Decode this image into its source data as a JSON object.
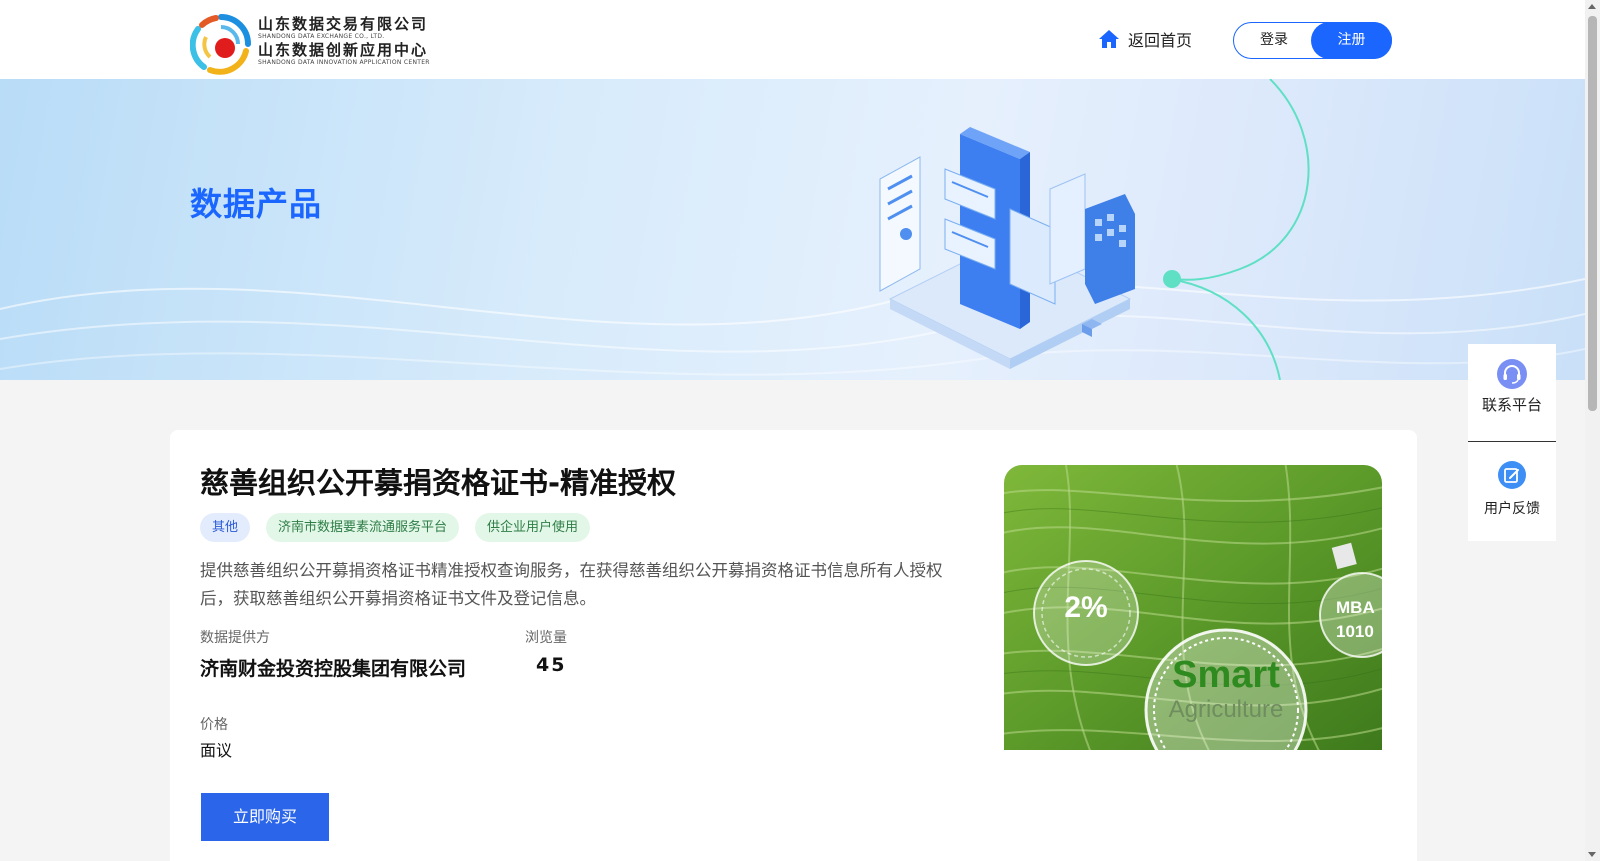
{
  "header": {
    "logo": {
      "line1_cn": "山东数据交易有限公司",
      "line1_en": "SHANDONG DATA EXCHANGE CO., LTD.",
      "line2_cn": "山东数据创新应用中心",
      "line2_en": "SHANDONG DATA INNOVATION APPLICATION CENTER"
    },
    "home_label": "返回首页",
    "login_label": "登录",
    "register_label": "注册"
  },
  "banner": {
    "title": "数据产品"
  },
  "product": {
    "title": "慈善组织公开募捐资格证书-精准授权",
    "tags": [
      {
        "label": "其他",
        "style": "blue"
      },
      {
        "label": "济南市数据要素流通服务平台",
        "style": "green"
      },
      {
        "label": "供企业用户使用",
        "style": "green"
      }
    ],
    "description": "提供慈善组织公开募捐资格证书精准授权查询服务，在获得慈善组织公开募捐资格证书信息所有人授权后，获取慈善组织公开募捐资格证书文件及登记信息。",
    "provider_label": "数据提供方",
    "provider_value": "济南财金投资控股集团有限公司",
    "views_label": "浏览量",
    "views_value": "45",
    "price_label": "价格",
    "price_value": "面议",
    "buy_label": "立即购买",
    "image": {
      "badge_percent": "2%",
      "badge_text_main": "Smart",
      "badge_text_sub": "Agriculture",
      "badge_side_1": "MBA",
      "badge_side_2": "1010"
    }
  },
  "side_panel": {
    "contact_label": "联系平台",
    "feedback_label": "用户反馈"
  },
  "colors": {
    "primary": "#1a66ff",
    "button": "#2b65e9",
    "tag_blue_bg": "#e3ecfd",
    "tag_green_bg": "#e3f7e8"
  },
  "icons": {
    "home": "home-icon",
    "contact": "headset-icon",
    "feedback": "edit-icon"
  }
}
